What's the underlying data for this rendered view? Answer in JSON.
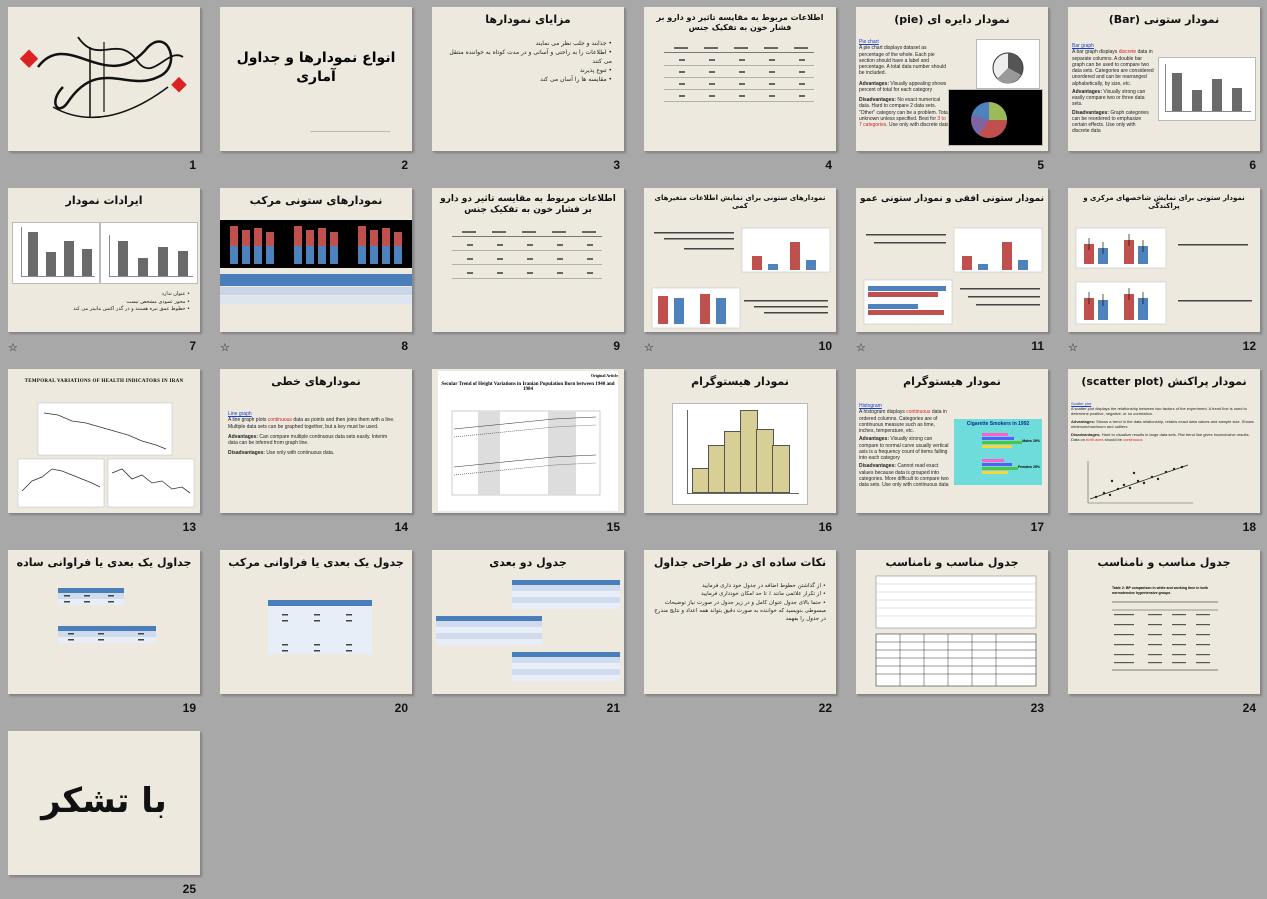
{
  "app": {
    "view": "slide-sorter"
  },
  "slides": [
    {
      "n": "1"
    },
    {
      "n": "2"
    },
    {
      "n": "3"
    },
    {
      "n": "4"
    },
    {
      "n": "5"
    },
    {
      "n": "6"
    },
    {
      "n": "7"
    },
    {
      "n": "8"
    },
    {
      "n": "9"
    },
    {
      "n": "10"
    },
    {
      "n": "11"
    },
    {
      "n": "12"
    },
    {
      "n": "13"
    },
    {
      "n": "14"
    },
    {
      "n": "15"
    },
    {
      "n": "16"
    },
    {
      "n": "17"
    },
    {
      "n": "18"
    },
    {
      "n": "19"
    },
    {
      "n": "20"
    },
    {
      "n": "21"
    },
    {
      "n": "22"
    },
    {
      "n": "23"
    },
    {
      "n": "24"
    },
    {
      "n": "25"
    }
  ],
  "s2": {
    "title": "انواع نمودارها و جداول آماری"
  },
  "s3": {
    "title": "مزایای نمودارها",
    "bullets": [
      "جذابند و جلب نظر می نمایند",
      "اطلاعات را به راحتی و آسانی و در مدت کوتاه به خواننده منتقل می کنند",
      "تنوع پذیرند",
      "مقایسه ها را آسان می کند"
    ]
  },
  "s4": {
    "title": "اطلاعات مربوط به مقایسه تاثیر دو دارو بر فشار خون به تفکیک جنس"
  },
  "s5": {
    "title": "نمودار دایره ای (pie)",
    "link": "Pie chart",
    "text": "A pie chart displays dataset as percentage of the whole. Each pie section should have a label and percentage. A total data number should be included.",
    "adv_label": "Advantages:",
    "adv": "Visually appealing shows percent of total for each category",
    "dis_label": "Disadvantages:",
    "dis": "No exact numerical data. Hard to compare 2 data sets. \"Other\" category can be a problem. Total unknown unless specified. Best for",
    "dis_red": "3 to 7 categories",
    "dis_end": "Use only with discrete data"
  },
  "s6": {
    "title": "نمودار ستونی (Bar)",
    "link": "Bar graph",
    "text_a": "A bar graph displays",
    "text_red": "discrete",
    "text_b": "data in separate columns. A double bar graph can be used to compare two data sets. Categories are considered unordered and can be rearranged alphabetically, by size, etc.",
    "adv_label": "Advantages:",
    "adv": "Visually strong can easily compare two or three data sets.",
    "dis_label": "Disadvantages:",
    "dis": "Graph categories can be reordered to emphasize certain effects. Use only with discrete data"
  },
  "s7": {
    "title": "ایرادات نمودار",
    "bullets": [
      "عنوان ندارد",
      "محور عمودی مشخص نیست",
      "خطوط عمق نیره هستند و در گذر اکنس مانیتر می کند"
    ]
  },
  "s8": {
    "title": "نمودارهای ستونی مرکب"
  },
  "s9": {
    "title": "اطلاعات مربوط به مقایسه تاثیر دو دارو بر فشار خون به تفکیک جنس"
  },
  "s10": {
    "title": "نمودارهای ستونی برای نمایش اطلاعات متغیرهای کمی"
  },
  "s11": {
    "title": "نمودار ستونی افقی و نمودار ستونی عمودی"
  },
  "s12": {
    "title": "نمودار ستونی برای نمایش شاخصهای مرکزی و پراکندگی"
  },
  "s13": {
    "title": "TEMPORAL VARIATIONS OF HEALTH INDICATORS IN IRAN"
  },
  "s14": {
    "title": "نمودارهای خطی",
    "link": "Line graph",
    "text_a": "A line graph plots",
    "text_red": "continuous",
    "text_b": "data as points and then joins them with a line. Multiple data sets can be graphed together, but a key must be used.",
    "adv_label": "Advantages:",
    "adv": "Can compare multiple continuous data sets easily. Interim data can be inferred from graph line.",
    "dis_label": "Disadvantages:",
    "dis": "Use only with continuous data."
  },
  "s15": {
    "tag": "Original Article",
    "title": "Secular Trend of Height Variations in Iranian Population Born between 1940 and 1984"
  },
  "s16": {
    "title": "نمودار هیستوگرام"
  },
  "s17": {
    "title": "نمودار هیستوگرام",
    "link": "Histogram",
    "text_a": "A histogram displays",
    "text_red": "continuous",
    "text_b": "data in ordered columns. Categories are of continuous measure such as time, inches, temperature, etc.",
    "adv_label": "Advantages:",
    "adv": "Visually strong can compare to normal curve usually vertical axis is a frequency count of items falling into each category",
    "dis_label": "Disadvantages:",
    "dis": "Cannot read exact values because data is grouped into categories. More difficult to compare two data sets. Use only with continuous data",
    "inset_title": "Cigarette Smokers in 1992",
    "inset_a": "Males 29%",
    "inset_b": "Females 25%"
  },
  "s18": {
    "title": "نمودار پراکنش (scatter plot)",
    "link": "Scatter plot",
    "text": "A scatter plot displays the relationship between two factors of the experiment. A trend line is used to determine positive, negative, or no correlation.",
    "adv_label": "Advantages:",
    "adv": "Shows a trend in the data relationship, retains exact data values and sample size. Shows minimum/maximum and outliers",
    "dis_label": "Disadvantages:",
    "dis": "Hard to visualize results in large data sets. Flat trend line gives inconclusive results. Data on",
    "dis_red1": "both axes",
    "dis_mid": "should be",
    "dis_red2": "continuous"
  },
  "s19": {
    "title": "جداول یک بعدی یا فراوانی ساده"
  },
  "s20": {
    "title": "جدول یک بعدی یا فراوانی مرکب"
  },
  "s21": {
    "title": "جدول دو بعدی"
  },
  "s22": {
    "title": "نکات ساده ای در طراحی جداول",
    "bullets": [
      "از گذاشتن خطوط اضافه در جدول خود داری فرمایید",
      "از تکرار علائمی مانند ٪ تا حد امکان خودداری فرمایید",
      "حتما بالای جدول عنوان کامل و در زیر جدول در صورت نیاز توضیحات مبسوطی بنویسید که خواننده به صورت دقیق بتواند همه اعداد و نتایج مندرج در جدول را بفهمد"
    ]
  },
  "s23": {
    "title": "جدول مناسب و نامناسب"
  },
  "s24": {
    "title": "جدول مناسب و نامناسب",
    "caption": "Table 2: BP comparison in white and working time in both normotensive hypertensive groups"
  },
  "s25": {
    "title": "با تشکر"
  },
  "colors": {
    "slide_bg": "#ede9df",
    "sorter_bg": "#a8a8a8",
    "bar_red": "#c0504d",
    "bar_blue": "#4f81bd",
    "bar_gray": "#707070",
    "hist_fill": "#d8cf96",
    "link": "#1a3fd1",
    "accent_red": "#d32222",
    "table_header": "#4a7ebb"
  },
  "icons": {
    "transition_marker": "transition-star-icon"
  }
}
